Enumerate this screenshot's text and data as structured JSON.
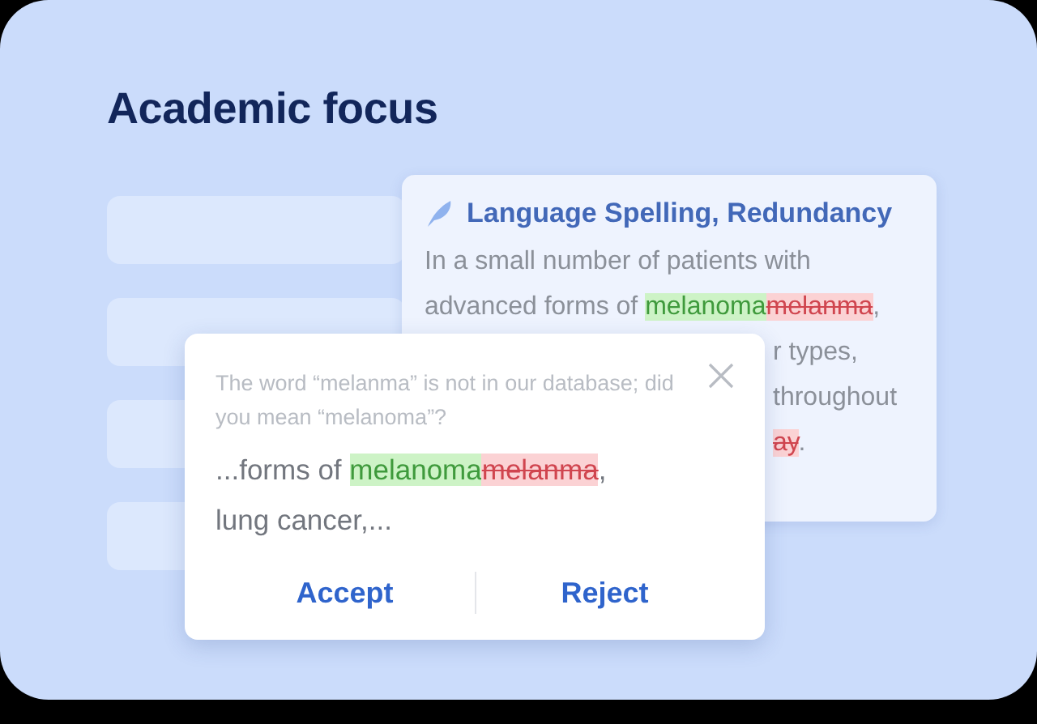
{
  "title": "Academic focus",
  "suggestion_card": {
    "heading": "Language Spelling, Redundancy",
    "lines": [
      {
        "kind": "full",
        "segments": [
          {
            "kind": "plain",
            "text": "In a small number of patients with"
          }
        ]
      },
      {
        "kind": "full",
        "segments": [
          {
            "kind": "plain",
            "text": "advanced forms of "
          },
          {
            "kind": "insert",
            "text": "melanoma"
          },
          {
            "kind": "delete",
            "text": "melanma"
          },
          {
            "kind": "plain",
            "text": ","
          }
        ]
      },
      {
        "kind": "tail",
        "segments": [
          {
            "kind": "plain",
            "text": "r types,"
          }
        ]
      },
      {
        "kind": "tail",
        "segments": [
          {
            "kind": "plain",
            "text": "throughout"
          }
        ]
      },
      {
        "kind": "tail",
        "segments": [
          {
            "kind": "delete",
            "text": "ay"
          },
          {
            "kind": "plain",
            "text": "."
          }
        ]
      }
    ]
  },
  "popup": {
    "question": "The word “melanma” is not in our database; did you mean “melanoma”?",
    "snippet": [
      [
        {
          "kind": "plain",
          "text": "...forms of "
        },
        {
          "kind": "insert",
          "text": "melanoma"
        },
        {
          "kind": "delete",
          "text": "melanma"
        },
        {
          "kind": "plain",
          "text": ","
        }
      ],
      [
        {
          "kind": "plain",
          "text": "lung cancer,..."
        }
      ]
    ],
    "buttons": [
      "Accept",
      "Reject"
    ]
  }
}
